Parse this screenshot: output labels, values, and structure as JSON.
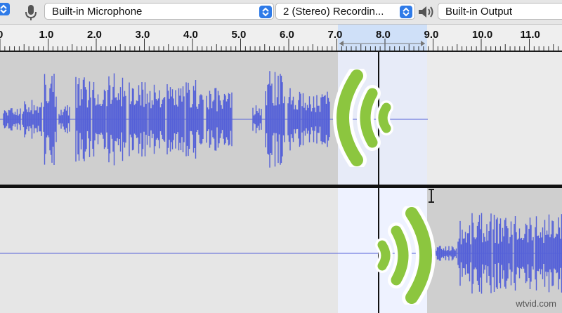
{
  "toolbar": {
    "input_device": "Built-in Microphone",
    "channels": "2 (Stereo) Recordin...",
    "output_device": "Built-in Output"
  },
  "ruler": {
    "ticks": [
      "0",
      "1.0",
      "2.0",
      "3.0",
      "4.0",
      "5.0",
      "6.0",
      "7.0",
      "8.0",
      "9.0",
      "10.0",
      "11.0"
    ]
  },
  "colors": {
    "waveform": "#5460d8",
    "selection": "#eef2ff",
    "wave_icon": "#8cc63f"
  },
  "icons": [
    "microphone-icon",
    "speaker-icon",
    "stepper-icon",
    "wave-signal-icon"
  ],
  "watermark": "wtvid.com"
}
